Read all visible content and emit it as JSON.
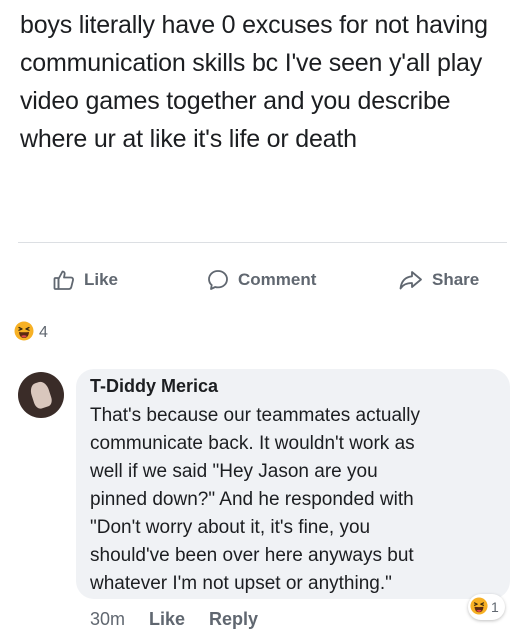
{
  "post": {
    "text": "boys literally have 0 excuses for not having communication skills bc I've seen y'all play video games together and you describe where ur at like it's life or death"
  },
  "actions": {
    "like_label": "Like",
    "comment_label": "Comment",
    "share_label": "Share"
  },
  "reactions": {
    "icon": "haha-icon",
    "count": "4"
  },
  "comment": {
    "author": "T-Diddy Merica",
    "text": "That's because our teammates actually\ncommunicate back. It wouldn't work as\nwell if we said \"Hey Jason are you\npinned down?\" And he responded with\n\"Don't worry about it, it's fine, you\nshould've been over here anyways but\nwhatever I'm not upset or anything.\"",
    "time": "30m",
    "like_label": "Like",
    "reply_label": "Reply",
    "reaction_icon": "haha-icon",
    "reaction_count": "1"
  },
  "colors": {
    "text": "#1c1e21",
    "muted": "#606770",
    "bubble": "#f0f2f5",
    "haha": "#f7b125"
  }
}
